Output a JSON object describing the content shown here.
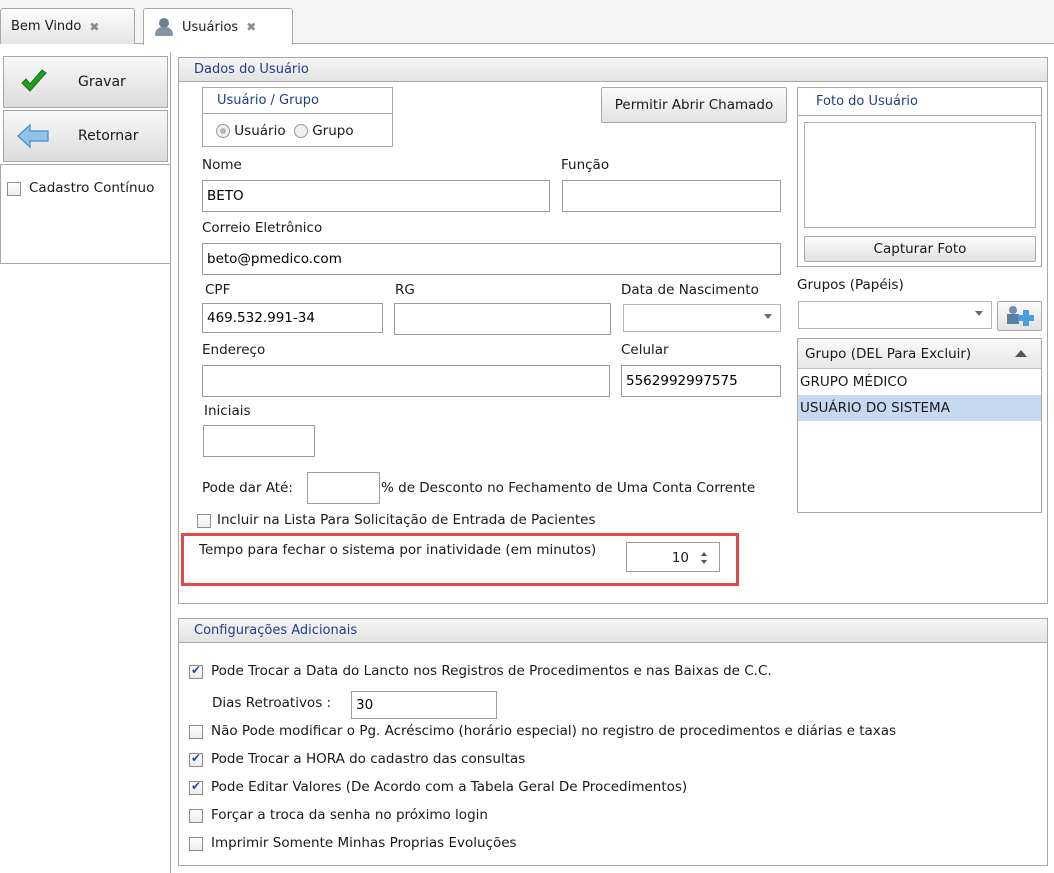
{
  "tabs": [
    {
      "label": "Bem Vindo",
      "close": "✖"
    },
    {
      "label": "Usuários",
      "close": "✖"
    }
  ],
  "toolbar": {
    "save_label": "Gravar",
    "back_label": "Retornar",
    "continuous_label": "Cadastro Contínuo",
    "continuous_checked": false
  },
  "dados": {
    "title": "Dados do Usuário",
    "usuario_grupo": {
      "title": "Usuário / Grupo",
      "option_user": "Usuário",
      "option_group": "Grupo",
      "selected": "Usuário"
    },
    "permitir_btn": "Permitir Abrir Chamado",
    "nome_label": "Nome",
    "nome_value": "BETO",
    "funcao_label": "Função",
    "funcao_value": "",
    "email_label": "Correio Eletrônico",
    "email_value": "beto@pmedico.com",
    "cpf_label": "CPF",
    "cpf_value": "469.532.991-34",
    "rg_label": "RG",
    "rg_value": "",
    "nasc_label": "Data de Nascimento",
    "nasc_value": "",
    "endereco_label": "Endereço",
    "endereco_value": "",
    "celular_label": "Celular",
    "celular_value": "5562992997575",
    "iniciais_label": "Iniciais",
    "iniciais_value": "",
    "desconto_prefix": "Pode dar Até:",
    "desconto_value": "",
    "desconto_suffix": "% de Desconto no Fechamento de Uma Conta Corrente",
    "incluir_label": "Incluir na Lista Para Solicitação de Entrada de Pacientes",
    "incluir_checked": false,
    "tempo_label": "Tempo para fechar o sistema por inatividade (em minutos)",
    "tempo_value": "10",
    "foto": {
      "title": "Foto do Usuário",
      "capture_btn": "Capturar Foto"
    },
    "grupos": {
      "label": "Grupos (Papéis)",
      "combo_value": "",
      "list_header": "Grupo (DEL Para Excluir)",
      "items": [
        "GRUPO MÉDICO",
        "USUÁRIO DO SISTEMA"
      ],
      "selected_index": 1
    }
  },
  "config": {
    "title": "Configurações Adicionais",
    "trocar_data_label": "Pode Trocar a Data do Lancto nos Registros de Procedimentos e nas Baixas de C.C.",
    "trocar_data_checked": true,
    "dias_label": "Dias Retroativos :",
    "dias_value": "30",
    "nao_modificar_label": "Não Pode modificar o Pg. Acréscimo (horário especial) no registro de procedimentos e diárias e taxas",
    "nao_modificar_checked": false,
    "trocar_hora_label": "Pode Trocar a HORA do cadastro das consultas",
    "trocar_hora_checked": true,
    "editar_valores_label": "Pode Editar Valores (De Acordo com a Tabela Geral De Procedimentos)",
    "editar_valores_checked": true,
    "forcar_senha_label": "Forçar a troca da senha no próximo login",
    "forcar_senha_checked": false,
    "imprimir_label": "Imprimir Somente Minhas Proprias Evoluções",
    "imprimir_checked": false
  },
  "colors": {
    "accent": "#1d3f86",
    "highlight": "#e24a4a",
    "selection": "#c5d9f1",
    "check": "#1fa01f",
    "arrow": "#5a9fd4"
  }
}
